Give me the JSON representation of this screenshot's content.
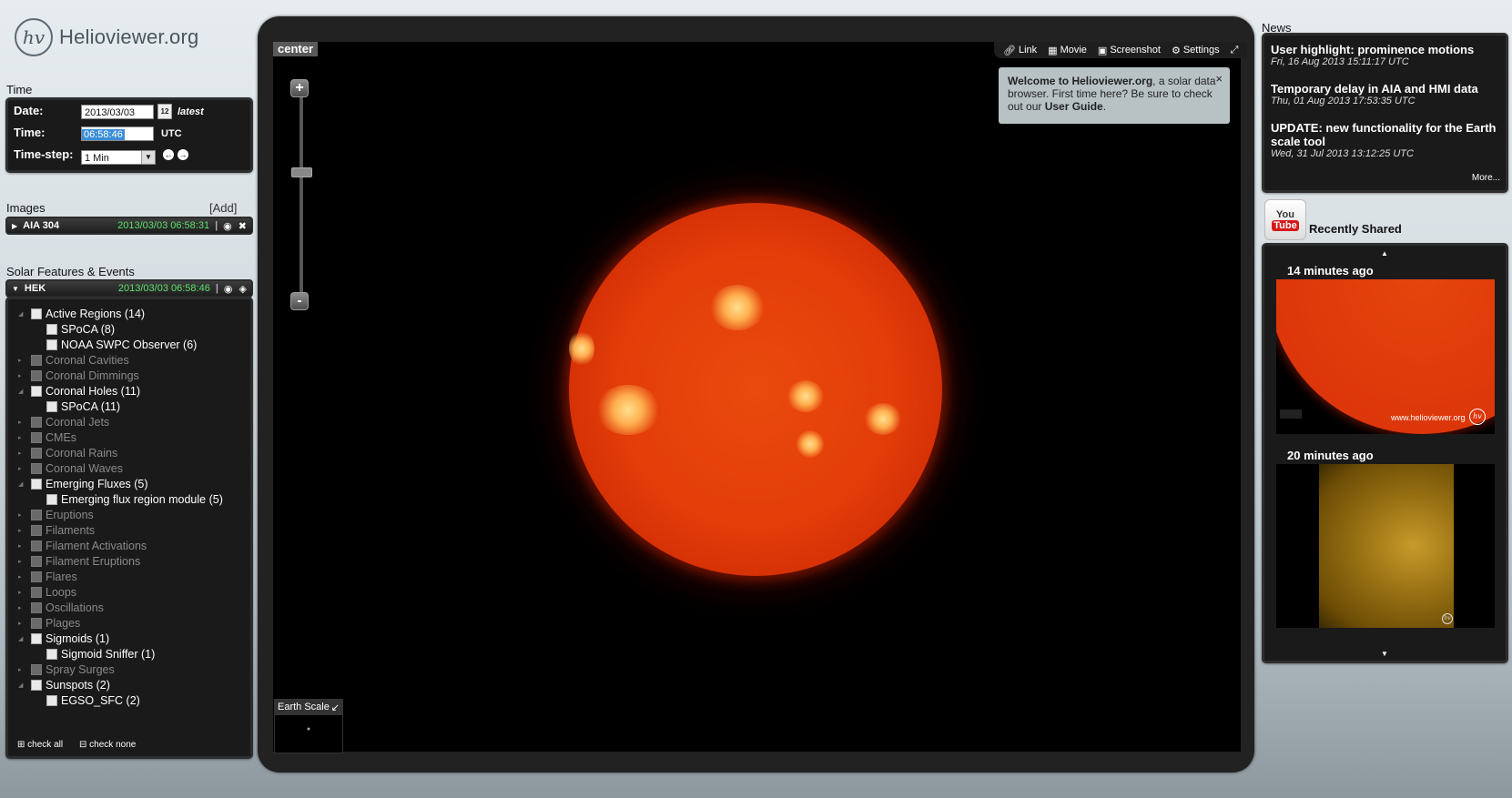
{
  "logo": {
    "mark": "hv",
    "name": "Helioviewer.org"
  },
  "time": {
    "section_title": "Time",
    "date_label": "Date:",
    "date_value": "2013/03/03",
    "calendar_day": "12",
    "latest": "latest",
    "time_label": "Time:",
    "time_value": "06:58:46",
    "utc": "UTC",
    "step_label": "Time-step:",
    "step_value": "1 Min"
  },
  "images": {
    "section_title": "Images",
    "add": "[Add]",
    "layer": {
      "name": "AIA 304",
      "timestamp": "2013/03/03 06:58:31"
    }
  },
  "events": {
    "section_title": "Solar Features & Events",
    "layer": {
      "name": "HEK",
      "timestamp": "2013/03/03 06:58:46"
    },
    "items": [
      {
        "label": "Active Regions (14)",
        "level": 0,
        "active": true
      },
      {
        "label": "SPoCA (8)",
        "level": 1,
        "active": true
      },
      {
        "label": "NOAA SWPC Observer (6)",
        "level": 1,
        "active": true
      },
      {
        "label": "Coronal Cavities",
        "level": 0,
        "active": false
      },
      {
        "label": "Coronal Dimmings",
        "level": 0,
        "active": false
      },
      {
        "label": "Coronal Holes (11)",
        "level": 0,
        "active": true
      },
      {
        "label": "SPoCA (11)",
        "level": 1,
        "active": true
      },
      {
        "label": "Coronal Jets",
        "level": 0,
        "active": false
      },
      {
        "label": "CMEs",
        "level": 0,
        "active": false
      },
      {
        "label": "Coronal Rains",
        "level": 0,
        "active": false
      },
      {
        "label": "Coronal Waves",
        "level": 0,
        "active": false
      },
      {
        "label": "Emerging Fluxes (5)",
        "level": 0,
        "active": true
      },
      {
        "label": "Emerging flux region module (5)",
        "level": 1,
        "active": true
      },
      {
        "label": "Eruptions",
        "level": 0,
        "active": false
      },
      {
        "label": "Filaments",
        "level": 0,
        "active": false
      },
      {
        "label": "Filament Activations",
        "level": 0,
        "active": false
      },
      {
        "label": "Filament Eruptions",
        "level": 0,
        "active": false
      },
      {
        "label": "Flares",
        "level": 0,
        "active": false
      },
      {
        "label": "Loops",
        "level": 0,
        "active": false
      },
      {
        "label": "Oscillations",
        "level": 0,
        "active": false
      },
      {
        "label": "Plages",
        "level": 0,
        "active": false
      },
      {
        "label": "Sigmoids (1)",
        "level": 0,
        "active": true
      },
      {
        "label": "Sigmoid Sniffer (1)",
        "level": 1,
        "active": true
      },
      {
        "label": "Spray Surges",
        "level": 0,
        "active": false
      },
      {
        "label": "Sunspots (2)",
        "level": 0,
        "active": true
      },
      {
        "label": "EGSO_SFC (2)",
        "level": 1,
        "active": true
      }
    ],
    "check_all": "check all",
    "check_none": "check none"
  },
  "viewport": {
    "center": "center",
    "toolbar": {
      "link": "Link",
      "movie": "Movie",
      "screenshot": "Screenshot",
      "settings": "Settings"
    },
    "welcome": {
      "bold": "Welcome to Helioviewer.org",
      "text": ", a solar data browser. First time here? Be sure to check out our ",
      "guide": "User Guide",
      "end": ".",
      "close": "×"
    },
    "zoom_in": "+",
    "zoom_out": "-",
    "earth_scale": "Earth Scale"
  },
  "news": {
    "section_title": "News",
    "items": [
      {
        "title": "User highlight: prominence motions",
        "date": "Fri, 16 Aug 2013 15:11:17 UTC"
      },
      {
        "title": "Temporary delay in AIA and HMI data",
        "date": "Thu, 01 Aug 2013 17:53:35 UTC"
      },
      {
        "title": "UPDATE: new functionality for the Earth scale tool",
        "date": "Wed, 31 Jul 2013 13:12:25 UTC"
      }
    ],
    "more": "More..."
  },
  "shared": {
    "youtube_top": "You",
    "youtube_bottom": "Tube",
    "title": "Recently Shared",
    "items": [
      {
        "age": "14 minutes ago",
        "watermark": "www.helioviewer.org",
        "mark": "hv"
      },
      {
        "age": "20 minutes ago",
        "mark": "hv"
      }
    ]
  }
}
